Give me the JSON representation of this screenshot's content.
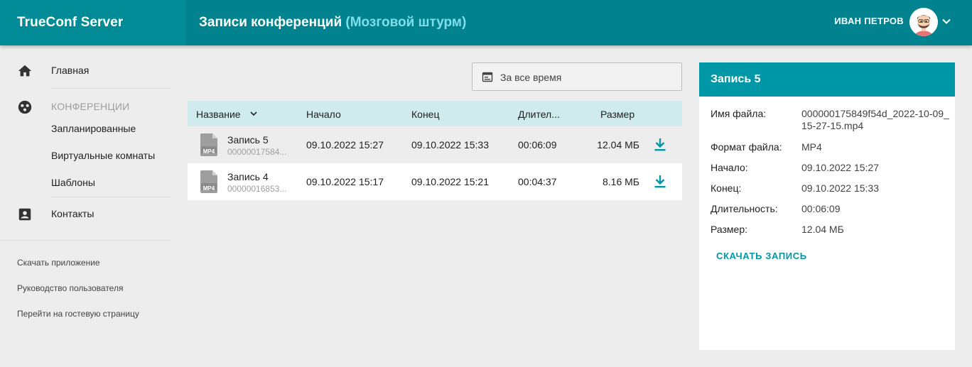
{
  "header": {
    "brand": "TrueConf Server",
    "title": "Записи конференций",
    "subtitle": "(Мозговой штурм)",
    "user_name": "ИВАН ПЕТРОВ"
  },
  "sidebar": {
    "home": "Главная",
    "conferences_section": "КОНФЕРЕНЦИИ",
    "scheduled": "Запланированные",
    "virtual_rooms": "Виртуальные комнаты",
    "templates": "Шаблоны",
    "contacts": "Контакты",
    "footer_links": [
      "Скачать приложение",
      "Руководство пользователя",
      "Перейти на гостевую страницу"
    ]
  },
  "filter": {
    "label": "За все время"
  },
  "table": {
    "columns": [
      "Название",
      "Начало",
      "Конец",
      "Длител...",
      "Размер"
    ],
    "rows": [
      {
        "name": "Запись 5",
        "file_id": "00000017584...",
        "start": "09.10.2022 15:27",
        "end": "09.10.2022 15:33",
        "duration": "00:06:09",
        "size": "12.04 МБ",
        "format_badge": "MP4"
      },
      {
        "name": "Запись 4",
        "file_id": "00000016853...",
        "start": "09.10.2022 15:17",
        "end": "09.10.2022 15:21",
        "duration": "00:04:37",
        "size": "8.16 МБ",
        "format_badge": "MP4"
      }
    ]
  },
  "details": {
    "title": "Запись 5",
    "labels": {
      "filename": "Имя файла:",
      "format": "Формат файла:",
      "start": "Начало:",
      "end": "Конец:",
      "duration": "Длительность:",
      "size": "Размер:"
    },
    "values": {
      "filename": "000000175849f54d_2022-10-09_15-27-15.mp4",
      "format": "MP4",
      "start": "09.10.2022 15:27",
      "end": "09.10.2022 15:33",
      "duration": "00:06:09",
      "size": "12.04 МБ"
    },
    "download_label": "СКАЧАТЬ ЗАПИСЬ"
  },
  "colors": {
    "header_bg": "#00838f",
    "accent": "#0097a7",
    "table_header_bg": "#d0ebed",
    "subtitle": "#80deea"
  }
}
